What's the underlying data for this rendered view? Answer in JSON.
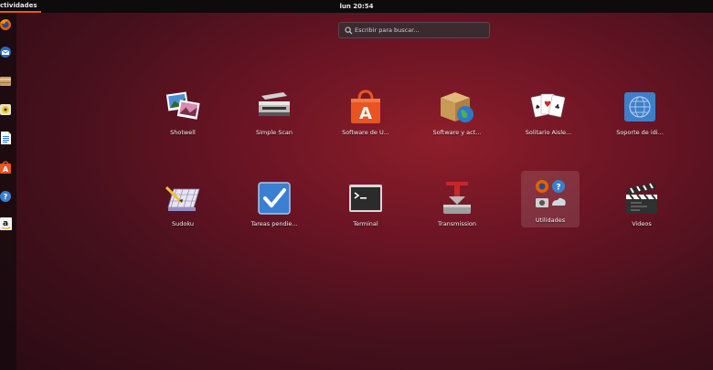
{
  "topbar": {
    "activities": "ctividades",
    "clock": "lun 20:54"
  },
  "search": {
    "placeholder": "Escribir para buscar..."
  },
  "dock": [
    {
      "name": "firefox-icon"
    },
    {
      "name": "thunderbird-icon"
    },
    {
      "name": "files-icon"
    },
    {
      "name": "rhythmbox-icon"
    },
    {
      "name": "libreoffice-writer-icon"
    },
    {
      "name": "software-center-icon"
    },
    {
      "name": "help-icon"
    },
    {
      "name": "amazon-icon"
    }
  ],
  "apps": [
    {
      "label": "Shotwell"
    },
    {
      "label": "Simple Scan"
    },
    {
      "label": "Software de U..."
    },
    {
      "label": "Software y act..."
    },
    {
      "label": "Solitario Aisle..."
    },
    {
      "label": "Soporte de idi..."
    },
    {
      "label": "Sudoku"
    },
    {
      "label": "Tareas pendie..."
    },
    {
      "label": "Terminal"
    },
    {
      "label": "Transmission"
    },
    {
      "label": "Utilidades"
    },
    {
      "label": "Videos"
    }
  ],
  "colors": {
    "accent": "#e95420",
    "panel": "#0d0b0c"
  }
}
